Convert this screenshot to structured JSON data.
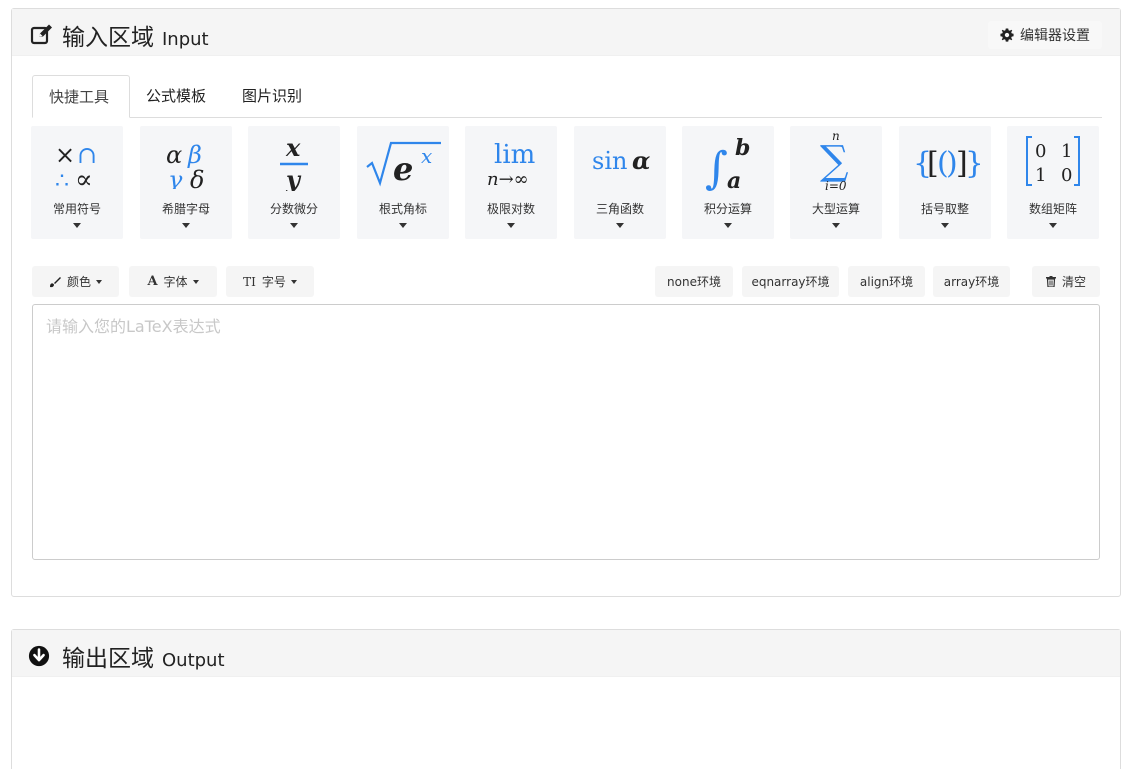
{
  "input_panel": {
    "title_zh": "输入区域",
    "title_en": "Input",
    "settings_label": "编辑器设置"
  },
  "tabs": [
    "快捷工具",
    "公式模板",
    "图片识别"
  ],
  "toolboxes": [
    {
      "label": "常用符号",
      "icon": "common-symbols-icon"
    },
    {
      "label": "希腊字母",
      "icon": "greek-letters-icon"
    },
    {
      "label": "分数微分",
      "icon": "fraction-icon"
    },
    {
      "label": "根式角标",
      "icon": "radical-icon"
    },
    {
      "label": "极限对数",
      "icon": "limit-icon"
    },
    {
      "label": "三角函数",
      "icon": "trig-icon"
    },
    {
      "label": "积分运算",
      "icon": "integral-icon"
    },
    {
      "label": "大型运算",
      "icon": "sum-icon"
    },
    {
      "label": "括号取整",
      "icon": "bracket-icon"
    },
    {
      "label": "数组矩阵",
      "icon": "matrix-icon"
    }
  ],
  "format": {
    "color": "颜色",
    "font": "字体",
    "size": "字号"
  },
  "environments": [
    "none环境",
    "eqnarray环境",
    "align环境",
    "array环境"
  ],
  "clear_label": "清空",
  "editor": {
    "placeholder": "请输入您的LaTeX表达式",
    "value": ""
  },
  "output_panel": {
    "title_zh": "输出区域",
    "title_en": "Output"
  },
  "colors": {
    "accent_blue": "#2f86eb",
    "heading_bg": "#f5f5f5",
    "toolbox_bg": "#f5f6f8"
  }
}
